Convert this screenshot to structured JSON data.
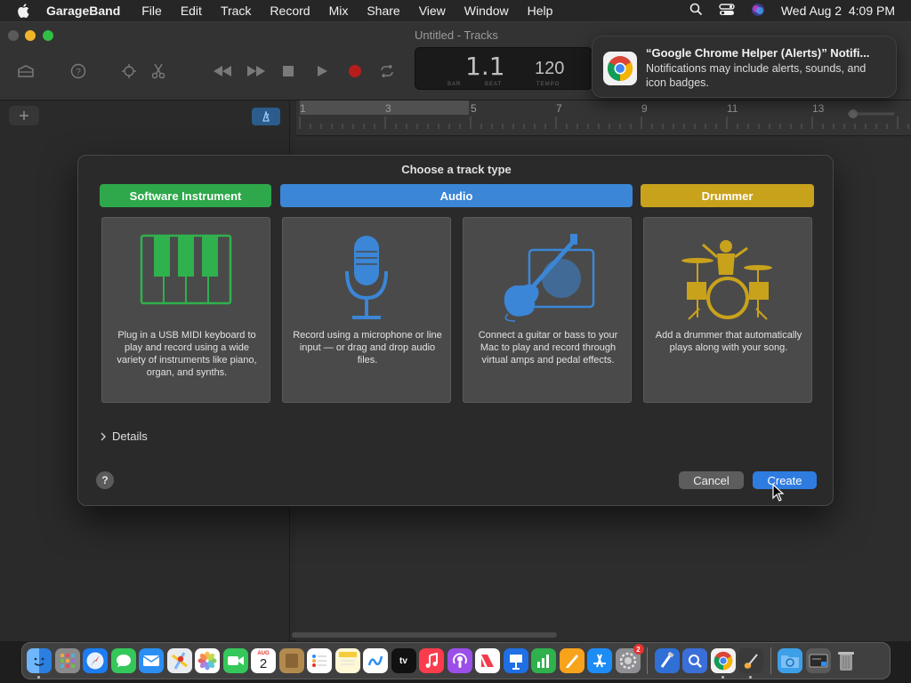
{
  "menubar": {
    "app_name": "GarageBand",
    "items": [
      "File",
      "Edit",
      "Track",
      "Record",
      "Mix",
      "Share",
      "View",
      "Window",
      "Help"
    ],
    "datetime": "Wed Aug 2  4:09 PM"
  },
  "window": {
    "title": "Untitled - Tracks",
    "lcd": {
      "position": "1.1",
      "tempo": "120",
      "label_bar": "BAR",
      "label_beat": "BEAT",
      "label_tempo": "TEMPO"
    },
    "ruler_marks": [
      "1",
      "3",
      "5",
      "7",
      "9",
      "11",
      "13"
    ]
  },
  "dialog": {
    "title": "Choose a track type",
    "categories": [
      {
        "label": "Software Instrument",
        "color": "#2ea84a"
      },
      {
        "label": "Audio",
        "color": "#3b86d6"
      },
      {
        "label": "Drummer",
        "color": "#c9a21c"
      }
    ],
    "cards": [
      {
        "desc": "Plug in a USB MIDI keyboard to play and record using a wide variety of instruments like piano, organ, and synths."
      },
      {
        "desc": "Record using a microphone or line input — or drag and drop audio files."
      },
      {
        "desc": "Connect a guitar or bass to your Mac to play and record through virtual amps and pedal effects."
      },
      {
        "desc": "Add a drummer that automatically plays along with your song."
      }
    ],
    "details_label": "Details",
    "help_label": "?",
    "cancel_label": "Cancel",
    "create_label": "Create"
  },
  "notification": {
    "title": "“Google Chrome Helper (Alerts)” Notifi...",
    "body": "Notifications may include alerts, sounds, and icon badges."
  },
  "dock": {
    "calendar_month": "AUG",
    "calendar_day": "2",
    "settings_badge": "2",
    "tv_label": "tv"
  }
}
